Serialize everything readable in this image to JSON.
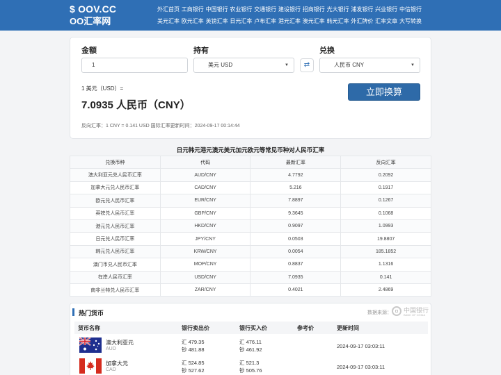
{
  "header": {
    "logo_line1": "$ OOV.CC",
    "logo_line2": "OO汇率网",
    "nav_row1": [
      "外汇首页",
      "工商银行",
      "中国银行",
      "农业银行",
      "交通银行",
      "建设银行",
      "招商银行",
      "光大银行",
      "浦发银行",
      "兴业银行",
      "中信银行"
    ],
    "nav_row2": [
      "美元汇率",
      "欧元汇率",
      "英镑汇率",
      "日元汇率",
      "卢布汇率",
      "港元汇率",
      "澳元汇率",
      "韩元汇率",
      "外汇牌价",
      "汇率文章",
      "大写转换"
    ]
  },
  "converter": {
    "amount_label": "金额",
    "have_label": "持有",
    "exchange_label": "兑换",
    "amount_value": "1",
    "have_value": "美元 USD",
    "exchange_value": "人民币 CNY",
    "swap_icon": "swap-arrows-icon",
    "result_small": "1 美元（USD）=",
    "result_big": "7.0935 人民币（CNY）",
    "convert_button": "立即换算",
    "reverse_info": "反向汇率：1 CNY = 0.141 USD    国际汇率更新时间：2024-09-17 00:14:44"
  },
  "rates_table": {
    "title": "日元韩元港元澳元美元加元欧元等常见币种对人民币汇率",
    "headers": [
      "兑换币种",
      "代码",
      "最新汇率",
      "反向汇率"
    ],
    "rows": [
      [
        "澳大利亚元兑人民币汇率",
        "AUD/CNY",
        "4.7792",
        "0.2092"
      ],
      [
        "加拿大元兑人民币汇率",
        "CAD/CNY",
        "5.216",
        "0.1917"
      ],
      [
        "欧元兑人民币汇率",
        "EUR/CNY",
        "7.8897",
        "0.1267"
      ],
      [
        "英镑兑人民币汇率",
        "GBP/CNY",
        "9.3645",
        "0.1068"
      ],
      [
        "港元兑人民币汇率",
        "HKD/CNY",
        "0.9097",
        "1.0993"
      ],
      [
        "日元兑人民币汇率",
        "JPY/CNY",
        "0.0503",
        "19.8807"
      ],
      [
        "韩元兑人民币汇率",
        "KRW/CNY",
        "0.0054",
        "185.1852"
      ],
      [
        "澳门币兑人民币汇率",
        "MOP/CNY",
        "0.8837",
        "1.1316"
      ],
      [
        "在岸人民币汇率",
        "USD/CNY",
        "7.0935",
        "0.141"
      ],
      [
        "南非兰特兑人民币汇率",
        "ZAR/CNY",
        "0.4021",
        "2.4869"
      ]
    ]
  },
  "hot": {
    "title": "热门货币",
    "source_label": "数据来源：",
    "boc_logo_text": "中国银行",
    "boc_logo_sub": "BANK OF CHINA",
    "headers": [
      "货币名称",
      "银行卖出价",
      "银行买入价",
      "参考价",
      "更新时间"
    ],
    "rows": [
      {
        "name": "澳大利亚元",
        "code": "AUD",
        "flag": "australia-flag-icon",
        "sell_hui": "汇 479.35",
        "sell_chao": "钞 481.88",
        "buy_hui": "汇 476.11",
        "buy_chao": "钞 461.92",
        "ref": "",
        "time": "2024-09-17 03:03:11"
      },
      {
        "name": "加拿大元",
        "code": "CAD",
        "flag": "canada-flag-icon",
        "sell_hui": "汇 524.85",
        "sell_chao": "钞 527.62",
        "buy_hui": "汇 521.3",
        "buy_chao": "钞 505.76",
        "ref": "",
        "time": "2024-09-17 03:03:11"
      }
    ]
  }
}
